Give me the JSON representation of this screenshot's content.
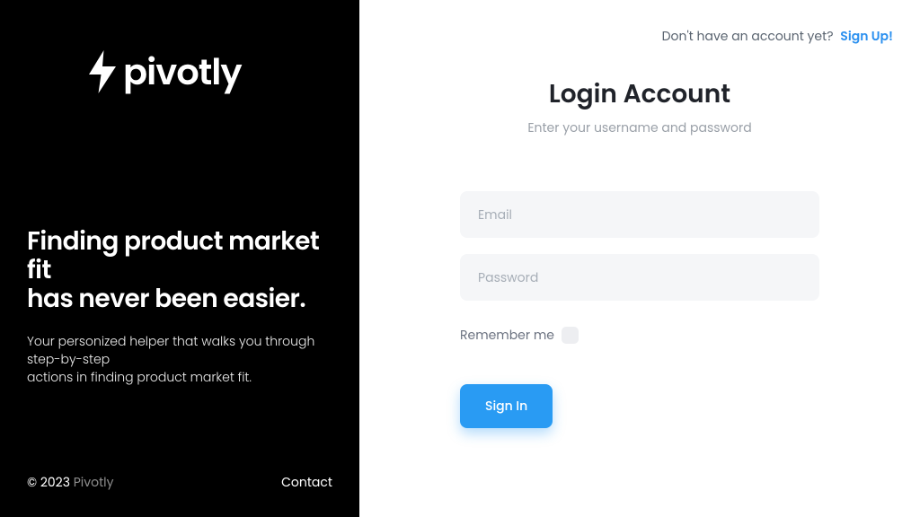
{
  "brand": {
    "name": "pivotly"
  },
  "hero": {
    "title_line1": "Finding product market fit",
    "title_line2": "has never been easier.",
    "subtitle_line1": "Your personized helper that walks you through step-by-step",
    "subtitle_line2": "actions in finding product market fit."
  },
  "footer": {
    "copyright_prefix": "© 2023 ",
    "copyright_brand": "Pivotly",
    "contact": "Contact"
  },
  "auth": {
    "prompt_text": "Don't have an account yet?",
    "signup_link": "Sign Up!",
    "title": "Login Account",
    "subtitle": "Enter your username and password",
    "email_placeholder": "Email",
    "password_placeholder": "Password",
    "remember_label": "Remember me",
    "signin_button": "Sign In"
  },
  "colors": {
    "accent": "#299bf3",
    "link": "#2b90ef"
  }
}
